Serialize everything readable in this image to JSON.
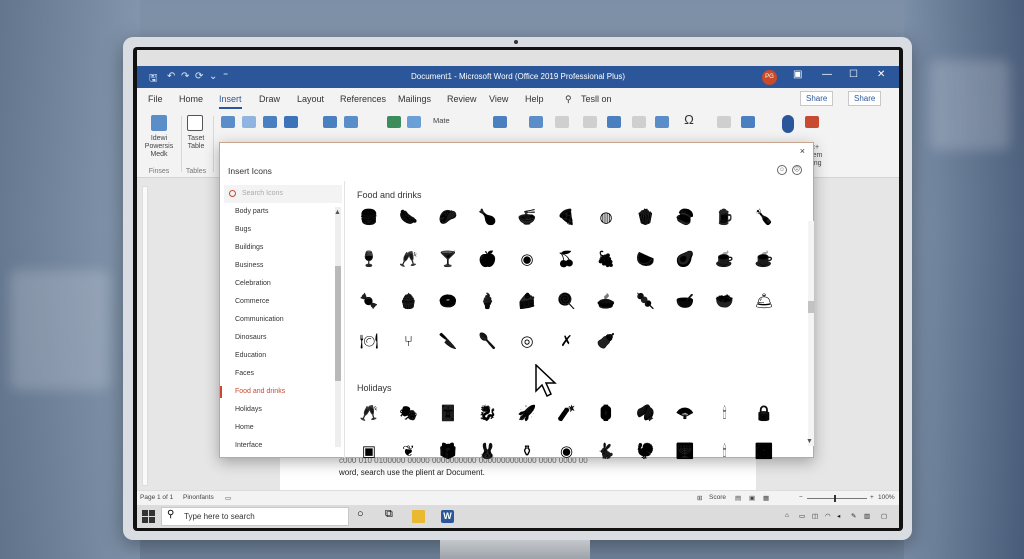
{
  "window": {
    "title": "Document1 - Microsoft Word (Office 2019 Professional Plus)",
    "user_initials": "PG"
  },
  "ribbon_tabs": [
    "File",
    "Home",
    "Insert",
    "Draw",
    "Layout",
    "References",
    "Mailings",
    "Review",
    "View",
    "Help"
  ],
  "active_tab": "Insert",
  "tell_me": "Tesll on",
  "share_buttons": [
    "Share",
    "Share"
  ],
  "ribbon": {
    "group1_button": [
      "Idewi",
      "Powersis",
      "Medk"
    ],
    "group1_name": "Finses",
    "table_button": [
      "Taset",
      "Table"
    ],
    "tables_group": "Tables",
    "math_label": "Mate",
    "screen_reading": [
      "Sc+",
      "Reem",
      "eding"
    ]
  },
  "document": {
    "line1": "c000 010 0100000 00000 0000000000 0000000000000 0000 0000 00",
    "line2": "word, search use the plient ar Document."
  },
  "status_bar": {
    "page": "Page 1 of 1",
    "words": "Pinonfants",
    "focus": "Score",
    "zoom": "100%"
  },
  "taskbar": {
    "search_placeholder": "Type here to search"
  },
  "dialog": {
    "title": "Insert Icons",
    "close": "×",
    "search_placeholder": "Search Icons",
    "categories": [
      "Body parts",
      "Bugs",
      "Buildings",
      "Business",
      "Celebration",
      "Commerce",
      "Communication",
      "Dinosaurs",
      "Education",
      "Faces",
      "Food and drinks",
      "Holidays",
      "Home",
      "Interface"
    ],
    "active_category": "Food and drinks",
    "sections": [
      {
        "title": "Food and drinks",
        "icons": [
          [
            "burger-fries",
            "hotdog",
            "taco",
            "drumstick",
            "ramen",
            "pizza-slice",
            "pizza",
            "popcorn",
            "sushi",
            "beer-mug",
            "bottle"
          ],
          [
            "wine-glass",
            "champagne-flute",
            "cocktail",
            "apple",
            "orange-slice",
            "cherries",
            "grapes",
            "watermelon",
            "avocado",
            "coffee-cup",
            "mug"
          ],
          [
            "candy",
            "muffin",
            "donut",
            "ice-cream",
            "cake-slice",
            "lollipop",
            "pie",
            "popsicle",
            "bowl",
            "salad-bowl",
            "cloche"
          ],
          [
            "place-setting",
            "fork",
            "knife",
            "spoon",
            "plate",
            "crossed-utensils",
            "baby-bottle"
          ]
        ]
      },
      {
        "title": "Holidays",
        "icons": [
          [
            "champagne-toast",
            "mask",
            "jester-hat",
            "dragon",
            "firework-rocket",
            "firecracker",
            "lantern",
            "fortune-cookie",
            "fan",
            "candles",
            "lock-heart"
          ],
          [
            "frame",
            "wreath",
            "gift",
            "bunny",
            "cauldron",
            "ornament",
            "rabbit",
            "turkey",
            "menorah",
            "kinara",
            "fireworks"
          ]
        ]
      }
    ]
  },
  "colors": {
    "title_bar": "#2b579a",
    "accent": "#c84b31",
    "dialog_border": "#c9a58e"
  }
}
